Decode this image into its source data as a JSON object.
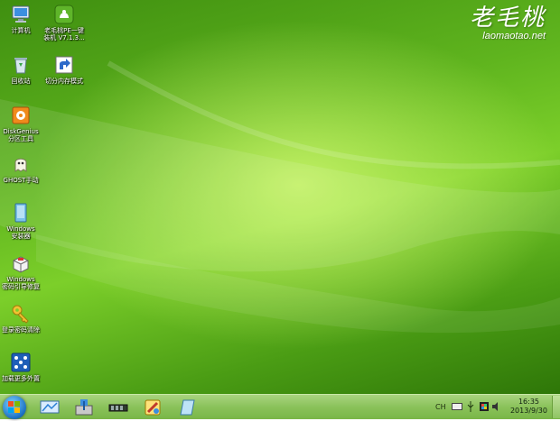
{
  "desktop": {
    "icons": [
      {
        "label": "计算机",
        "icon": "computer-icon"
      },
      {
        "label": "老毛桃PE一键",
        "label2": "装机 V7.1.3...",
        "icon": "lmt-install-icon"
      },
      {
        "label": "回收站",
        "icon": "recycle-bin-icon"
      },
      {
        "label": "切分内存模式",
        "icon": "shortcut-icon"
      },
      {
        "label": "DiskGenius",
        "label2": "分区工具",
        "icon": "diskgenius-icon"
      },
      {
        "label": "GHOST手动",
        "icon": "ghost-icon"
      },
      {
        "label": "Windows",
        "label2": "安装器",
        "icon": "windows-installer-icon"
      },
      {
        "label": "Windows",
        "label2": "密码引导修复",
        "icon": "windows-repair-icon"
      },
      {
        "label": "登录密码清除",
        "icon": "key-icon"
      },
      {
        "label": "加载更多外置",
        "icon": "load-more-icon"
      }
    ]
  },
  "brand": {
    "logo": "老毛桃",
    "url": "laomaotao.net"
  },
  "taskbar": {
    "apps": [
      "network-app-icon",
      "install-app-icon",
      "memory-app-icon",
      "tools-app-icon",
      "disk-app-icon"
    ],
    "tray": {
      "ime": "CH",
      "time": "16:35",
      "date": "2013/9/30"
    }
  },
  "colors": {
    "desktop": "#6cc422",
    "taskbar": "#8ac25a"
  }
}
